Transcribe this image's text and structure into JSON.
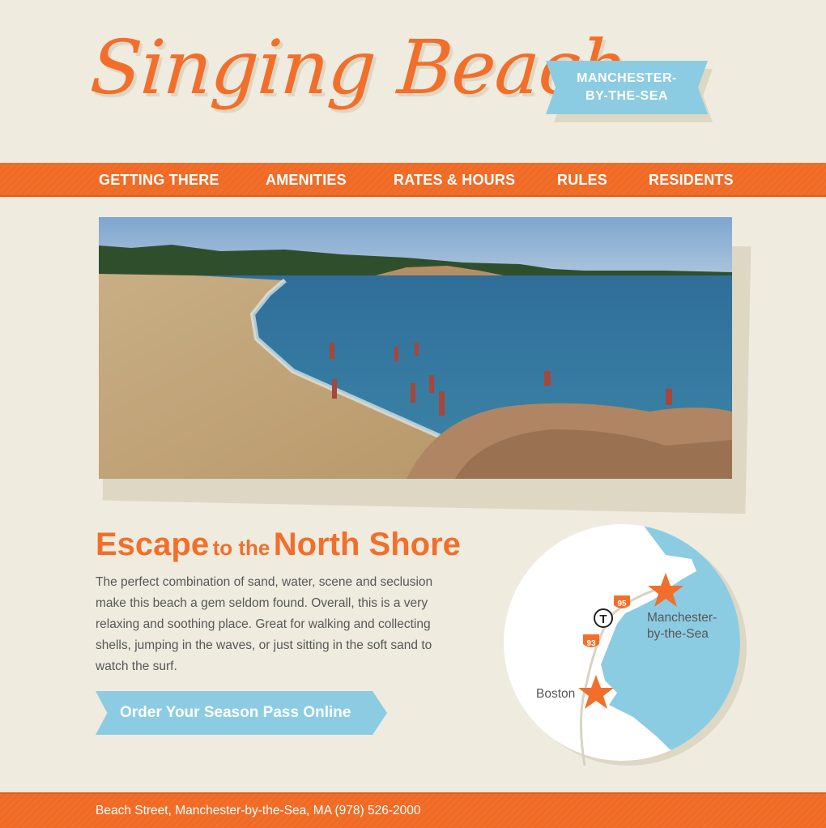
{
  "site": {
    "title": "Singing Beach",
    "badge": "MANCHESTER-\nBY-THE-SEA"
  },
  "nav": {
    "items": [
      {
        "label": "GETTING THERE"
      },
      {
        "label": "AMENITIES"
      },
      {
        "label": "RATES & HOURS"
      },
      {
        "label": "RULES"
      },
      {
        "label": "RESIDENTS"
      }
    ]
  },
  "hero": {
    "image": "beach-photo"
  },
  "intro": {
    "headline_part1": "Escape",
    "headline_part2": "to the",
    "headline_part3": "North Shore",
    "body": "The perfect combination of sand, water, scene and seclusion make this beach a gem seldom found. Overall, this is a very relaxing and soothing place. Great for walking and collecting shells, jumping in the waves, or just sitting in the soft sand to watch the surf."
  },
  "cta": {
    "label": "Order Your Season Pass Online"
  },
  "map": {
    "label_manchester_line1": "Manchester-",
    "label_manchester_line2": "by-the-Sea",
    "label_boston": "Boston",
    "route_95": "95",
    "route_93": "93",
    "transit": "T"
  },
  "footer": {
    "address": "Beach Street, Manchester-by-the-Sea, MA (978) 526-2000"
  },
  "colors": {
    "accent": "#f26f2b",
    "blue": "#8ccce2",
    "background": "#efebdf"
  }
}
